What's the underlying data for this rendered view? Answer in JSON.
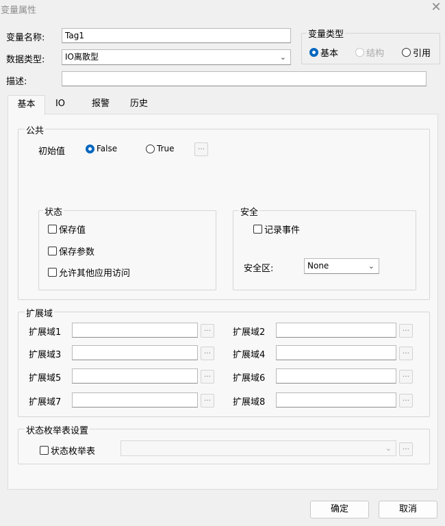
{
  "window": {
    "title": "变量属性",
    "close_glyph": "✕"
  },
  "form": {
    "name_label": "变量名称:",
    "name_value": "Tag1",
    "datatype_label": "数据类型:",
    "datatype_value": "IO离散型",
    "desc_label": "描述:",
    "desc_value": ""
  },
  "var_type": {
    "title": "变量类型",
    "options": [
      {
        "label": "基本",
        "selected": true,
        "enabled": true
      },
      {
        "label": "结构",
        "selected": false,
        "enabled": false
      },
      {
        "label": "引用",
        "selected": false,
        "enabled": true
      }
    ]
  },
  "tabs": [
    {
      "label": "基本",
      "active": true
    },
    {
      "label": "IO",
      "active": false
    },
    {
      "label": "报警",
      "active": false
    },
    {
      "label": "历史",
      "active": false
    }
  ],
  "basic": {
    "public": {
      "title": "公共",
      "initial_label": "初始值",
      "false_label": "False",
      "true_label": "True",
      "initial_selected": "False",
      "more_glyph": "…"
    },
    "status": {
      "title": "状态",
      "checks": [
        {
          "label": "保存值",
          "checked": false
        },
        {
          "label": "保存参数",
          "checked": false
        },
        {
          "label": "允许其他应用访问",
          "checked": false
        }
      ]
    },
    "security": {
      "title": "安全",
      "record_label": "记录事件",
      "record_checked": false,
      "zone_label": "安全区:",
      "zone_value": "None"
    },
    "ext": {
      "title": "扩展域",
      "fields": [
        {
          "label": "扩展域1",
          "value": ""
        },
        {
          "label": "扩展域2",
          "value": ""
        },
        {
          "label": "扩展域3",
          "value": ""
        },
        {
          "label": "扩展域4",
          "value": ""
        },
        {
          "label": "扩展域5",
          "value": ""
        },
        {
          "label": "扩展域6",
          "value": ""
        },
        {
          "label": "扩展域7",
          "value": ""
        },
        {
          "label": "扩展域8",
          "value": ""
        }
      ]
    },
    "enum": {
      "title": "状态枚举表设置",
      "check_label": "状态枚举表",
      "checked": false,
      "value": ""
    }
  },
  "buttons": {
    "ok": "确定",
    "cancel": "取消"
  },
  "icons": {
    "chevron": "chevron-down-icon",
    "close": "close-icon"
  }
}
